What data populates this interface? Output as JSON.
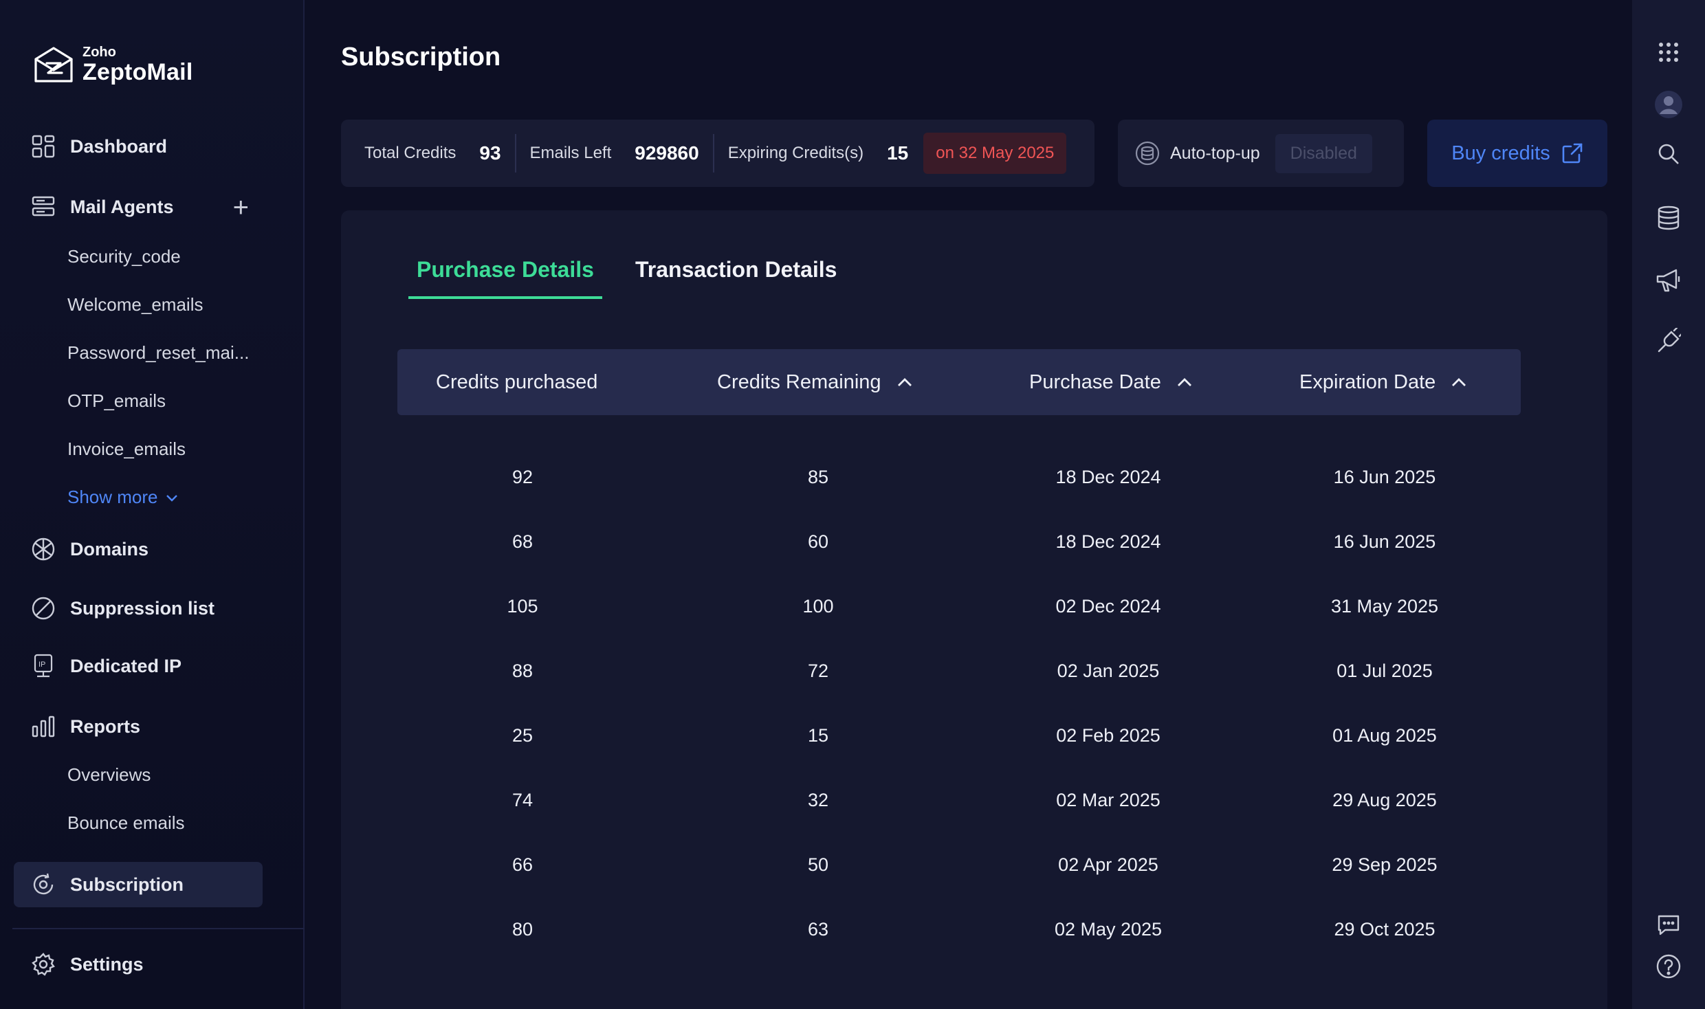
{
  "brand": {
    "small": "Zoho",
    "name": "ZeptoMail"
  },
  "sidebar": {
    "dashboard": "Dashboard",
    "mail_agents": "Mail Agents",
    "agents": [
      "Security_code",
      "Welcome_emails",
      "Password_reset_mai...",
      "OTP_emails",
      "Invoice_emails"
    ],
    "show_more": "Show more",
    "domains": "Domains",
    "suppression": "Suppression list",
    "dedicated_ip": "Dedicated IP",
    "reports": "Reports",
    "report_items": [
      "Overviews",
      "Bounce emails"
    ],
    "subscription": "Subscription",
    "settings": "Settings"
  },
  "page": {
    "title": "Subscription"
  },
  "stats": {
    "total_credits_label": "Total Credits",
    "total_credits": "93",
    "emails_left_label": "Emails Left",
    "emails_left": "929860",
    "expiring_label": "Expiring Credits(s)",
    "expiring": "15",
    "expiring_on": "on 32 May 2025"
  },
  "autotopup": {
    "label": "Auto-top-up",
    "status": "Disabled"
  },
  "buy_credits": "Buy credits",
  "tabs": {
    "purchase": "Purchase Details",
    "transaction": "Transaction Details"
  },
  "table": {
    "headers": [
      "Credits purchased",
      "Credits Remaining",
      "Purchase Date",
      "Expiration Date"
    ],
    "rows": [
      [
        "92",
        "85",
        "18 Dec 2024",
        "16 Jun 2025"
      ],
      [
        "68",
        "60",
        "18 Dec 2024",
        "16 Jun 2025"
      ],
      [
        "105",
        "100",
        "02 Dec 2024",
        "31 May 2025"
      ],
      [
        "88",
        "72",
        "02 Jan 2025",
        "01 Jul 2025"
      ],
      [
        "25",
        "15",
        "02 Feb 2025",
        "01 Aug 2025"
      ],
      [
        "74",
        "32",
        "02 Mar 2025",
        "29 Aug 2025"
      ],
      [
        "66",
        "50",
        "02 Apr 2025",
        "29 Sep 2025"
      ],
      [
        "80",
        "63",
        "02 May 2025",
        "29 Oct 2025"
      ]
    ]
  },
  "colors": {
    "accent_green": "#3ddc97",
    "link_blue": "#4f86f7",
    "danger_red": "#f05555",
    "background": "#0d0f24"
  }
}
